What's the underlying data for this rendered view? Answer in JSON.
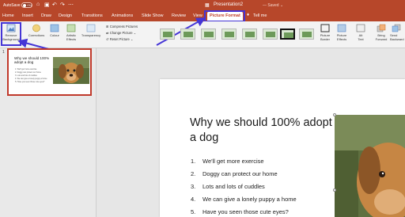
{
  "titlebar": {
    "autosave_label": "AutoSave",
    "toggle_label": "ON",
    "doc_title": "Presentation2",
    "doc_status": "— Saved ⌄",
    "icons": [
      "home-icon",
      "save-icon",
      "undo-icon",
      "redo-icon",
      "more-icon"
    ]
  },
  "tabs": {
    "items": [
      "Home",
      "Insert",
      "Draw",
      "Design",
      "Transitions",
      "Animations",
      "Slide Show",
      "Review",
      "View",
      "Picture Format"
    ],
    "tell_me": "Tell me",
    "active": "Picture Format"
  },
  "ribbon": {
    "remove_bg": "Remove Background",
    "remove_bg_1": "Remove",
    "remove_bg_2": "Background",
    "corrections": "Corrections",
    "colour": "Colour",
    "artistic_1": "Artistic",
    "artistic_2": "Effects",
    "transparency": "Transparency",
    "compress": "Compress Pictures",
    "change": "Change Picture",
    "reset": "Reset Picture",
    "picture_border_1": "Picture",
    "picture_border_2": "Border",
    "picture_effects_1": "Picture",
    "picture_effects_2": "Effects",
    "alt_text_1": "Alt",
    "alt_text_2": "Text",
    "bring_forward_1": "Bring",
    "bring_forward_2": "Forward",
    "send_backward_1": "Send",
    "send_backward_2": "Backward"
  },
  "thumbnail": {
    "number": "1",
    "title": "Why we should 100% adopt a dog",
    "bullets": [
      "1. We'll get more exercise",
      "2. Doggy can protect our home",
      "3. Lots and lots of cuddles",
      "4. We can give a lonely puppy a home",
      "5. Have you seen those cute eyes?"
    ]
  },
  "slide": {
    "title": "Why we should 100% adopt a dog",
    "bullets": [
      {
        "num": "1.",
        "text": "We'll get more exercise"
      },
      {
        "num": "2.",
        "text": "Doggy can protect our home"
      },
      {
        "num": "3.",
        "text": "Lots and lots of cuddles"
      },
      {
        "num": "4.",
        "text": "We can give a lonely puppy a home"
      },
      {
        "num": "5.",
        "text": "Have you seen those cute eyes?"
      }
    ]
  },
  "colors": {
    "brand": "#b7472a",
    "annotation": "#4535d6",
    "selection": "#c0392b"
  }
}
